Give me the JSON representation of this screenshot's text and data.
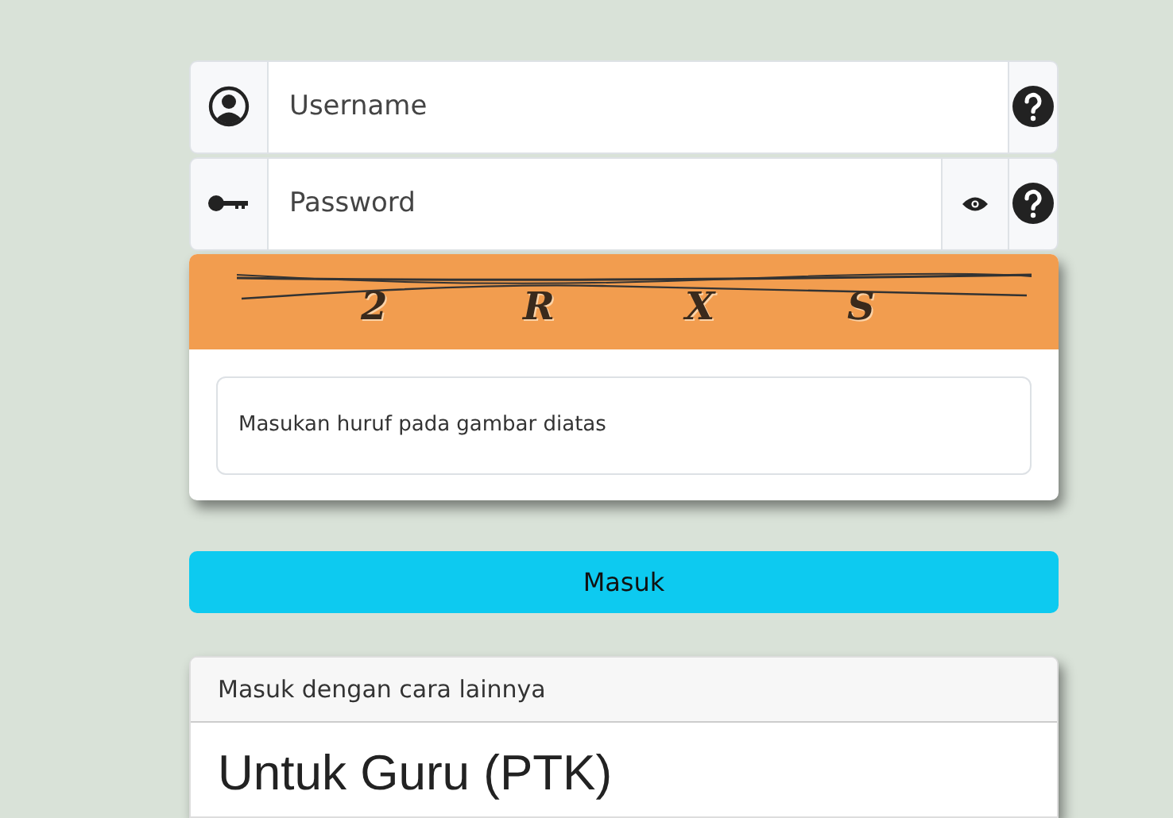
{
  "login_fields": [
    {
      "kind": "user",
      "placeholder": "Username",
      "reveal": false
    },
    {
      "kind": "password",
      "placeholder": "Password",
      "reveal": true
    }
  ],
  "captcha": {
    "characters": [
      "2",
      "R",
      "X",
      "S"
    ],
    "input": {
      "placeholder": "Masukan huruf pada gambar diatas"
    }
  },
  "submit_button": "Masuk",
  "alternative_login": {
    "header": "Masuk dengan cara lainnya",
    "title": "Untuk Guru (PTK)"
  }
}
